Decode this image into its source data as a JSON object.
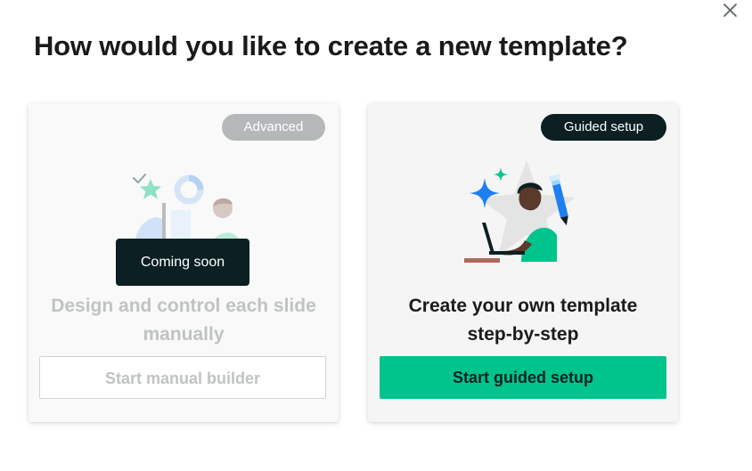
{
  "dialog": {
    "title": "How would you like to create a new template?",
    "close_icon": "close-icon"
  },
  "cards": {
    "manual": {
      "badge": "Advanced",
      "tooltip": "Coming soon",
      "title_line1": "Design and control each slide",
      "title_line2": "manually",
      "button_label": "Start manual builder",
      "illustration": "manual-builder-illustration",
      "disabled": true
    },
    "guided": {
      "badge": "Guided setup",
      "title_line1": "Create your own template",
      "title_line2": "step-by-step",
      "button_label": "Start guided setup",
      "illustration": "guided-setup-illustration"
    }
  },
  "colors": {
    "accent": "#00c48c",
    "dark": "#0c1f22",
    "muted_text": "#c0c3c3",
    "badge_muted": "#b5b8b9"
  }
}
